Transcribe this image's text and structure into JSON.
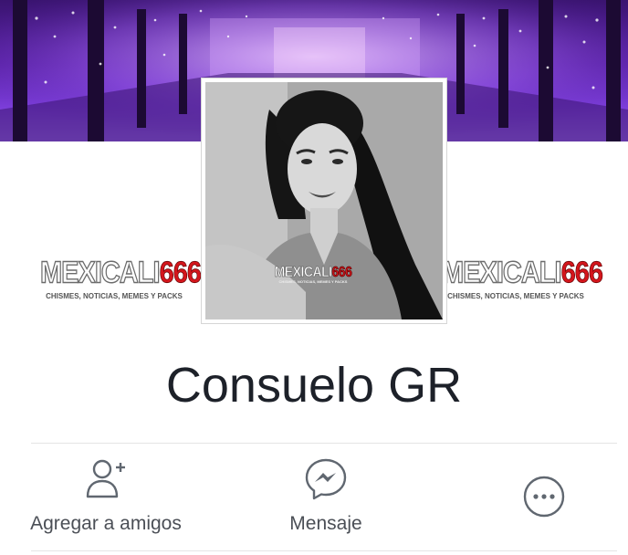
{
  "cover": {
    "description_icon": "cover-photo"
  },
  "watermark": {
    "brand_white": "MEXICALI",
    "brand_red": "666",
    "tagline": "CHISMES, NOTICIAS, MEMES Y PACKS"
  },
  "profile": {
    "name": "Consuelo GR"
  },
  "actions": {
    "add_friend": {
      "label": "Agregar a amigos",
      "icon": "add-friend-icon"
    },
    "message": {
      "label": "Mensaje",
      "icon": "messenger-icon"
    },
    "more": {
      "icon": "more-options-icon"
    }
  },
  "colors": {
    "text": "#1d2129",
    "secondary_text": "#4b4f56",
    "icon": "#606770",
    "brand_red": "#d4161c",
    "cover_purple": "#5a22a8"
  }
}
